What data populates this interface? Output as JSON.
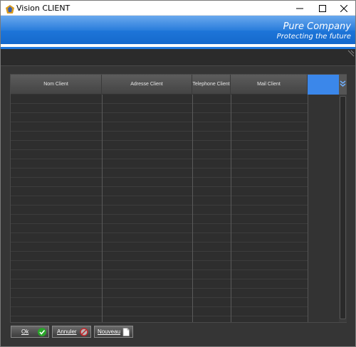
{
  "window": {
    "title": "Vision CLIENT",
    "controls": [
      "minimize-icon",
      "maximize-icon",
      "close-icon"
    ]
  },
  "banner": {
    "company": "Pure Company",
    "tagline": "Protecting the future",
    "color": "#1f77db"
  },
  "grid": {
    "columns": [
      {
        "label": "Nom Client"
      },
      {
        "label": "Adresse Client"
      },
      {
        "label": "Telephone Client"
      },
      {
        "label": "Mail Client"
      }
    ],
    "rows": [],
    "accent_color": "#3b87ea"
  },
  "buttons": {
    "ok": {
      "label": "Ok",
      "icon": "checkmark-icon"
    },
    "annuler": {
      "label": "Annuler",
      "icon": "cancel-icon"
    },
    "nouveau": {
      "label": "Nouveau",
      "icon": "new-document-icon"
    }
  }
}
